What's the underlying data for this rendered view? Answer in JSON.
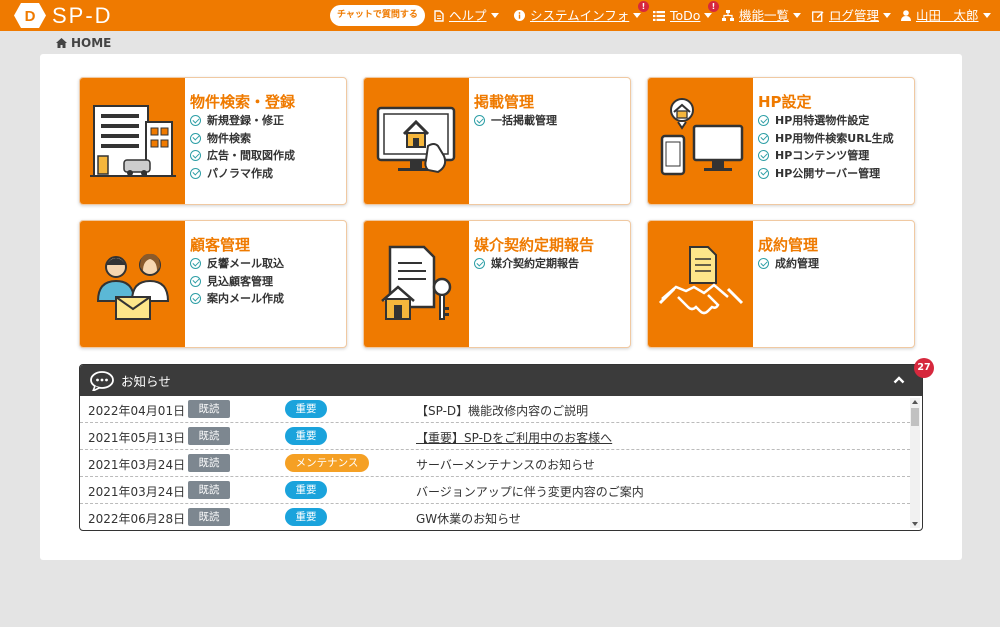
{
  "header": {
    "logo_text": "SP-D",
    "chat_button": "チャットで質問する",
    "nav": [
      {
        "label": "ヘルプ",
        "icon": "document-icon",
        "alert": ""
      },
      {
        "label": "システムインフォ",
        "icon": "info-icon",
        "alert": "!"
      },
      {
        "label": "ToDo",
        "icon": "list-icon",
        "alert": "!"
      },
      {
        "label": "機能一覧",
        "icon": "sitemap-icon",
        "alert": ""
      },
      {
        "label": "ログ管理",
        "icon": "edit-icon",
        "alert": ""
      },
      {
        "label": "山田　太郎",
        "icon": "user-icon",
        "alert": ""
      }
    ]
  },
  "breadcrumb": {
    "label": "HOME"
  },
  "cards": [
    {
      "title": "物件検索・登録",
      "items": [
        "新規登録・修正",
        "物件検索",
        "広告・間取図作成",
        "パノラマ作成"
      ],
      "icon": "building-icon"
    },
    {
      "title": "掲載管理",
      "items": [
        "一括掲載管理"
      ],
      "icon": "monitor-house-icon"
    },
    {
      "title": "HP設定",
      "items": [
        "HP用特選物件設定",
        "HP用物件検索URL生成",
        "HPコンテンツ管理",
        "HP公開サーバー管理"
      ],
      "icon": "devices-icon"
    },
    {
      "title": "顧客管理",
      "items": [
        "反響メール取込",
        "見込顧客管理",
        "案内メール作成"
      ],
      "icon": "customers-icon"
    },
    {
      "title": "媒介契約定期報告",
      "items": [
        "媒介契約定期報告"
      ],
      "icon": "contract-key-icon"
    },
    {
      "title": "成約管理",
      "items": [
        "成約管理"
      ],
      "icon": "handshake-icon"
    }
  ],
  "news": {
    "title": "お知らせ",
    "count": "27",
    "rows": [
      {
        "date": "2022年04月01日",
        "status": "既読",
        "category": "重要",
        "category_color": "#1aa3dc",
        "text": "【SP-D】機能改修内容のご説明",
        "underline": false
      },
      {
        "date": "2021年05月13日",
        "status": "既読",
        "category": "重要",
        "category_color": "#1aa3dc",
        "text": "【重要】SP-Dをご利用中のお客様へ",
        "underline": true
      },
      {
        "date": "2021年03月24日",
        "status": "既読",
        "category": "メンテナンス",
        "category_color": "#f5a024",
        "text": "サーバーメンテナンスのお知らせ",
        "underline": false
      },
      {
        "date": "2021年03月24日",
        "status": "既読",
        "category": "重要",
        "category_color": "#1aa3dc",
        "text": "バージョンアップに伴う変更内容のご案内",
        "underline": false
      },
      {
        "date": "2022年06月28日",
        "status": "既読",
        "category": "重要",
        "category_color": "#1aa3dc",
        "text": "GW休業のお知らせ",
        "underline": false
      }
    ]
  },
  "colors": {
    "brand": "#ef7a00",
    "accent_check": "#2e9fa6",
    "alert": "#d6283d"
  }
}
